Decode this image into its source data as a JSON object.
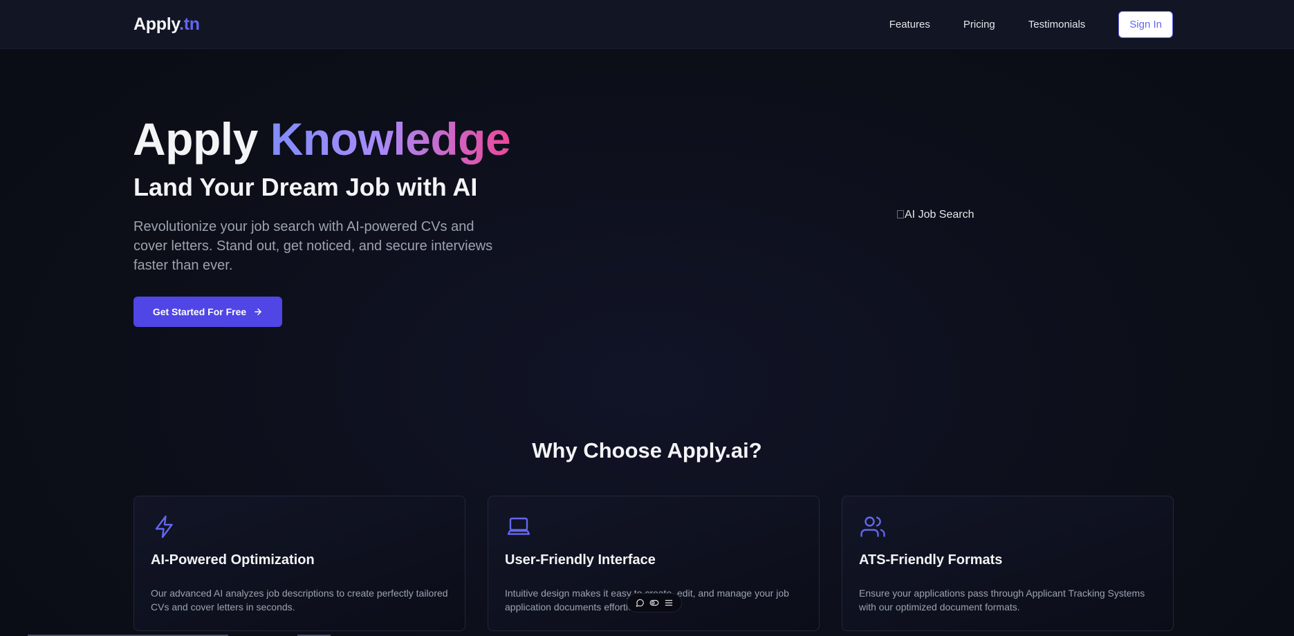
{
  "header": {
    "logo_main": "Apply",
    "logo_accent": ".tn",
    "nav": [
      "Features",
      "Pricing",
      "Testimonials"
    ],
    "signin_label": "Sign In"
  },
  "hero": {
    "title_word1": "Apply",
    "title_word2": "Knowledge",
    "subtitle": "Land Your Dream Job with AI",
    "description": "Revolutionize your job search with AI-powered CVs and cover letters. Stand out, get noticed, and secure interviews faster than ever.",
    "cta_label": "Get Started For Free",
    "image_alt": "AI Job Search"
  },
  "features": {
    "title": "Why Choose Apply.ai?",
    "cards": [
      {
        "icon": "lightning-icon",
        "title": "AI-Powered Optimization",
        "description": "Our advanced AI analyzes job descriptions to create perfectly tailored CVs and cover letters in seconds."
      },
      {
        "icon": "laptop-icon",
        "title": "User-Friendly Interface",
        "description": "Intuitive design makes it easy to create, edit, and manage your job application documents effortlessly."
      },
      {
        "icon": "users-icon",
        "title": "ATS-Friendly Formats",
        "description": "Ensure your applications pass through Applicant Tracking Systems with our optimized document formats."
      }
    ]
  },
  "colors": {
    "accent": "#6366f1",
    "cta": "#4f46e5",
    "background": "#0d0f1a"
  }
}
